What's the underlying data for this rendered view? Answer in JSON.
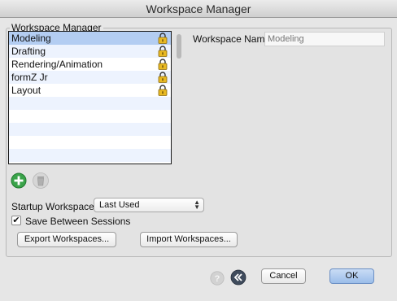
{
  "window": {
    "title": "Workspace Manager"
  },
  "group": {
    "label": "Workspace Manager"
  },
  "workspaces": [
    {
      "label": "Modeling",
      "locked": true,
      "selected": true
    },
    {
      "label": "Drafting",
      "locked": true,
      "selected": false
    },
    {
      "label": "Rendering/Animation",
      "locked": true,
      "selected": false
    },
    {
      "label": "formZ Jr",
      "locked": true,
      "selected": false
    },
    {
      "label": "Layout",
      "locked": true,
      "selected": false
    }
  ],
  "name_field": {
    "label": "Workspace Name",
    "placeholder": "Modeling"
  },
  "list_actions": {
    "add_icon": "plus-icon",
    "delete_icon": "trash-icon"
  },
  "startup": {
    "label": "Startup Workspace:",
    "value": "Last Used"
  },
  "save_sessions": {
    "label": "Save Between Sessions",
    "checked": true
  },
  "buttons": {
    "export": "Export Workspaces...",
    "import": "Import Workspaces...",
    "cancel": "Cancel",
    "ok": "OK"
  },
  "footer_icons": {
    "help": "help-icon",
    "back": "back-icon"
  },
  "colors": {
    "selection": "#b3cdf2",
    "default_button": "#9bbde9",
    "add_button": "#3aa34a"
  }
}
